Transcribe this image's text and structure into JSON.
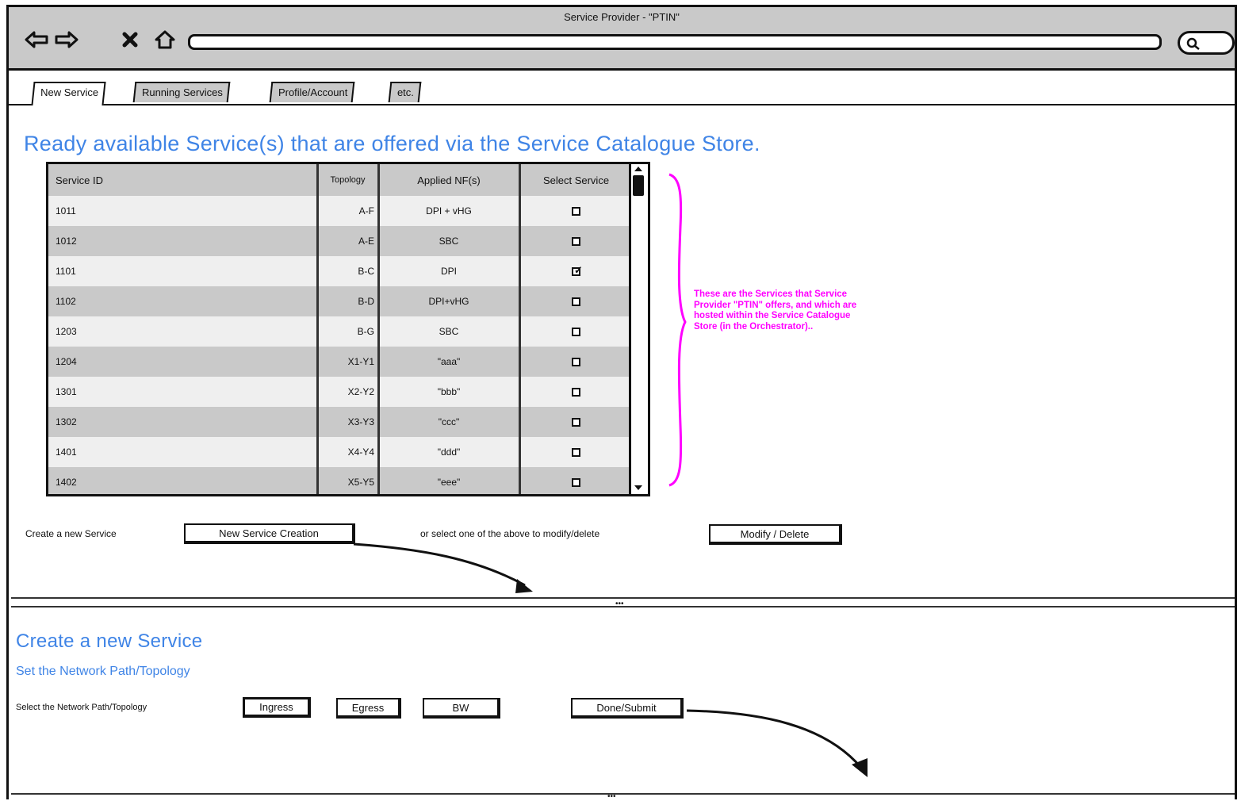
{
  "window": {
    "title": "Service Provider - \"PTIN\""
  },
  "tabs": [
    {
      "label": "New Service"
    },
    {
      "label": "Running Services"
    },
    {
      "label": "Profile/Account"
    },
    {
      "label": "etc."
    }
  ],
  "catalogue": {
    "heading": "Ready available Service(s) that are offered via the Service Catalogue Store.",
    "columns": [
      "Service ID",
      "Topology",
      "Applied NF(s)",
      "Select Service"
    ],
    "rows": [
      {
        "id": "1011",
        "topology": "A-F",
        "nf": "DPI + vHG",
        "selected": false
      },
      {
        "id": "1012",
        "topology": "A-E",
        "nf": "SBC",
        "selected": false
      },
      {
        "id": "1101",
        "topology": "B-C",
        "nf": "DPI",
        "selected": true
      },
      {
        "id": "1102",
        "topology": "B-D",
        "nf": "DPI+vHG",
        "selected": false
      },
      {
        "id": "1203",
        "topology": "B-G",
        "nf": "SBC",
        "selected": false
      },
      {
        "id": "1204",
        "topology": "X1-Y1",
        "nf": "\"aaa\"",
        "selected": false
      },
      {
        "id": "1301",
        "topology": "X2-Y2",
        "nf": "\"bbb\"",
        "selected": false
      },
      {
        "id": "1302",
        "topology": "X3-Y3",
        "nf": "\"ccc\"",
        "selected": false
      },
      {
        "id": "1401",
        "topology": "X4-Y4",
        "nf": "\"ddd\"",
        "selected": false
      },
      {
        "id": "1402",
        "topology": "X5-Y5",
        "nf": "\"eee\"",
        "selected": false
      }
    ],
    "note": "These are the Services that Service Provider \"PTIN\" offers, and which are hosted within the Service Catalogue Store (in the Orchestrator)..",
    "note_color": "#ff00ff"
  },
  "actions": {
    "create_label": "Create a new Service",
    "create_button": "New Service Creation",
    "modify_label": "or select one of the above to modify/delete",
    "modify_button": "Modify / Delete"
  },
  "create": {
    "heading": "Create a new Service",
    "subheading": "Set the Network Path/Topology",
    "select_label": "Select the Network Path/Topology",
    "ingress_button": "Ingress",
    "egress_button": "Egress",
    "bw_button": "BW",
    "submit_button": "Done/Submit"
  },
  "colors": {
    "heading_blue": "#3f84e6",
    "chrome_gray": "#c9c9c9"
  }
}
